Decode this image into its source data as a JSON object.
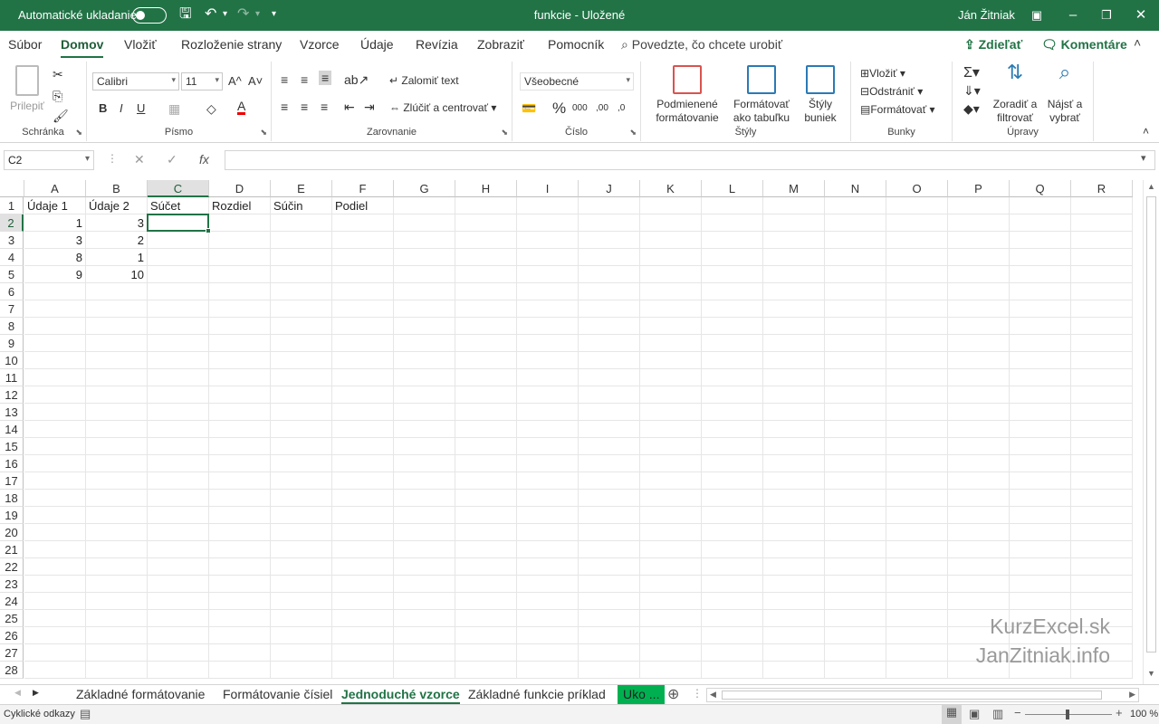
{
  "titlebar": {
    "autosave_label": "Automatické ukladanie",
    "title": "funkcie  -  Uložené",
    "user": "Ján Žitniak"
  },
  "menu": {
    "tabs": [
      "Súbor",
      "Domov",
      "Vložiť",
      "Rozloženie strany",
      "Vzorce",
      "Údaje",
      "Revízia",
      "Zobraziť",
      "Pomocník"
    ],
    "active": "Domov",
    "tell_me": "Povedzte, čo chcete urobiť",
    "share": "Zdieľať",
    "comments": "Komentáre"
  },
  "ribbon": {
    "clipboard": {
      "label": "Schránka",
      "paste": "Prilepiť"
    },
    "font": {
      "label": "Písmo",
      "name": "Calibri",
      "size": "11",
      "grow": "A^",
      "shrink": "A˅",
      "bold": "B",
      "italic": "I",
      "underline": "U",
      "color_letter": "A"
    },
    "alignment": {
      "label": "Zarovnanie",
      "wrap": "Zalomiť text",
      "merge": "Zlúčiť a centrovať"
    },
    "number": {
      "label": "Číslo",
      "format": "Všeobecné",
      "percent": "%",
      "thousands": "000",
      "inc_decimal": ",00",
      "dec_decimal": ",0"
    },
    "styles": {
      "label": "Štýly",
      "conditional": [
        "Podmienené",
        "formátovanie"
      ],
      "table": [
        "Formátovať",
        "ako tabuľku"
      ],
      "cell": [
        "Štýly",
        "buniek"
      ]
    },
    "cells": {
      "label": "Bunky",
      "insert": "Vložiť",
      "delete": "Odstrániť",
      "format": "Formátovať"
    },
    "editing": {
      "label": "Úpravy",
      "sort": [
        "Zoradiť a",
        "filtrovať"
      ],
      "find": [
        "Nájsť a",
        "vybrať"
      ]
    }
  },
  "formula": {
    "namebox": "C2",
    "value": ""
  },
  "columns": [
    "A",
    "B",
    "C",
    "D",
    "E",
    "F",
    "G",
    "H",
    "I",
    "J",
    "K",
    "L",
    "M",
    "N",
    "O",
    "P",
    "Q",
    "R"
  ],
  "selected_col": "C",
  "selected_row": 2,
  "rows": 28,
  "cells": {
    "A1": "Údaje 1",
    "B1": "Údaje 2",
    "C1": "Súčet",
    "D1": "Rozdiel",
    "E1": "Súčin",
    "F1": "Podiel",
    "A2": "1",
    "B2": "3",
    "A3": "3",
    "B3": "2",
    "A4": "8",
    "B4": "1",
    "A5": "9",
    "B5": "10"
  },
  "watermark": [
    "KurzExcel.sk",
    "JanZitniak.info"
  ],
  "sheets": [
    "Základné formátovanie",
    "Formátovanie čísiel",
    "Jednoduché vzorce",
    "Základné funkcie príklad",
    "Uko ..."
  ],
  "active_sheet": "Jednoduché vzorce",
  "status": {
    "text": "Cyklické odkazy",
    "zoom": "100 %"
  },
  "colors": {
    "accent": "#217346",
    "green_tab": "#00b050"
  }
}
